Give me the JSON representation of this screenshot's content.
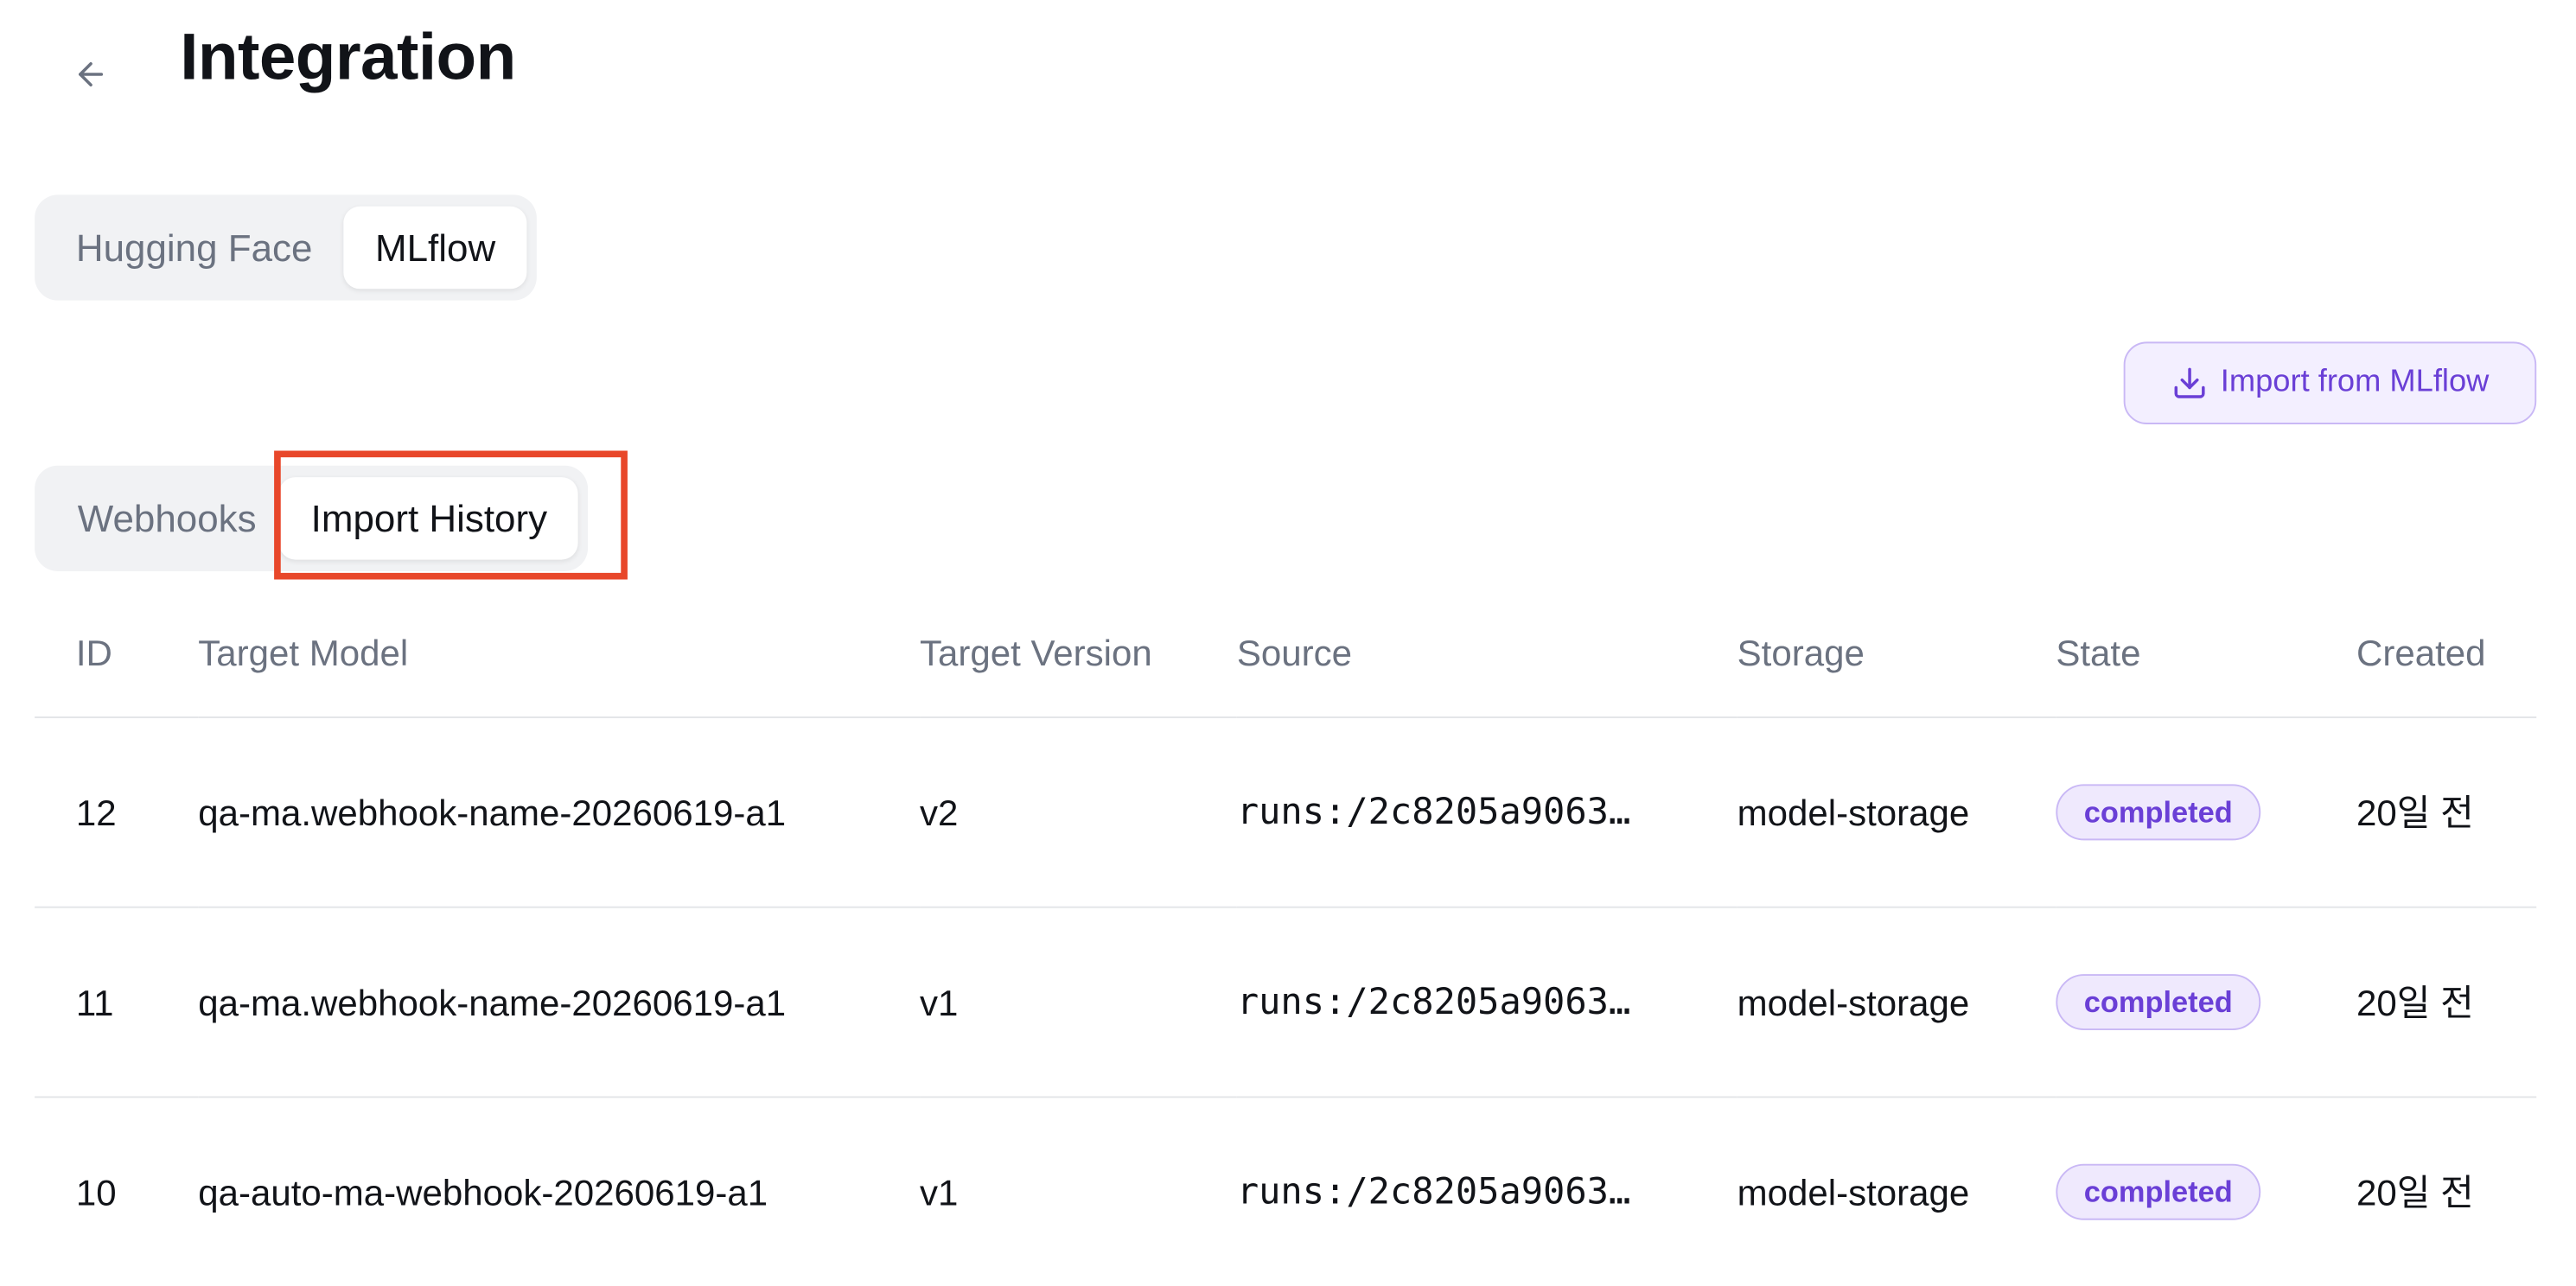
{
  "header": {
    "back_icon": "arrow-left-icon",
    "title": "Integration"
  },
  "provider_tabs": [
    {
      "label": "Hugging Face",
      "active": false
    },
    {
      "label": "MLflow",
      "active": true
    }
  ],
  "actions": {
    "import_label": "Import from MLflow",
    "import_icon": "download-icon"
  },
  "sub_tabs": [
    {
      "label": "Webhooks",
      "active": false
    },
    {
      "label": "Import History",
      "active": true
    }
  ],
  "table": {
    "columns": [
      "ID",
      "Target Model",
      "Target Version",
      "Source",
      "Storage",
      "State",
      "Created"
    ],
    "rows": [
      {
        "id": "12",
        "model": "qa-ma.webhook-name-20260619-a1",
        "version": "v2",
        "source": "runs:/2c8205a9063…",
        "storage": "model-storage",
        "state": "completed",
        "created": "20일 전"
      },
      {
        "id": "11",
        "model": "qa-ma.webhook-name-20260619-a1",
        "version": "v1",
        "source": "runs:/2c8205a9063…",
        "storage": "model-storage",
        "state": "completed",
        "created": "20일 전"
      },
      {
        "id": "10",
        "model": "qa-auto-ma-webhook-20260619-a1",
        "version": "v1",
        "source": "runs:/2c8205a9063…",
        "storage": "model-storage",
        "state": "completed",
        "created": "20일 전"
      }
    ]
  },
  "colors": {
    "accent": "#6a3fd6",
    "badge_bg": "#efe9fd",
    "highlight": "#e8472a",
    "muted_text": "#6b7280"
  }
}
